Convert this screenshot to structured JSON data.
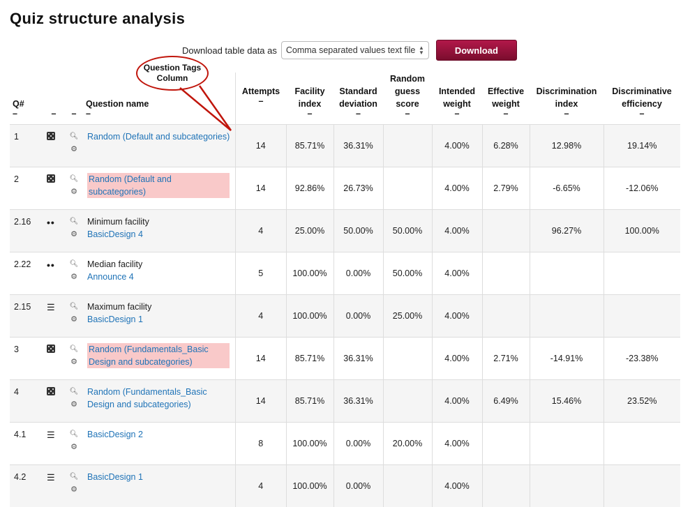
{
  "page_title": "Quiz structure analysis",
  "download": {
    "label": "Download table data as",
    "format": "Comma separated values text file",
    "button": "Download"
  },
  "annotation": {
    "line1": "Question Tags",
    "line2": "Column"
  },
  "headers": {
    "q": "Q#",
    "name": "Question name",
    "attempts": "Attempts",
    "facility": "Facility index",
    "stddev": "Standard deviation",
    "guess": "Random guess score",
    "intended": "Intended weight",
    "effective": "Effective weight",
    "disc_index": "Discrimination index",
    "disc_eff": "Discriminative efficiency",
    "sort_mark": "–"
  },
  "icons": {
    "preview": "search-icon",
    "settings": "gear-icon",
    "random": "dice-icon",
    "multi": "dots-icon",
    "list": "list-icon"
  },
  "rows": [
    {
      "q": "1",
      "name": "Random (Default and subcategories)",
      "sub": "",
      "link": true,
      "highlight": false,
      "icon": "dice",
      "attempts": "14",
      "facility": "85.71%",
      "stddev": "36.31%",
      "guess": "",
      "intended": "4.00%",
      "effective": "6.28%",
      "disc_index": "12.98%",
      "disc_eff": "19.14%"
    },
    {
      "q": "2",
      "name": "Random (Default and subcategories)",
      "sub": "",
      "link": true,
      "highlight": true,
      "icon": "dice",
      "attempts": "14",
      "facility": "92.86%",
      "stddev": "26.73%",
      "guess": "",
      "intended": "4.00%",
      "effective": "2.79%",
      "disc_index": "-6.65%",
      "disc_eff": "-12.06%"
    },
    {
      "q": "2.16",
      "name": "Minimum facility",
      "sub": "BasicDesign 4",
      "link": false,
      "highlight": false,
      "icon": "dots",
      "attempts": "4",
      "facility": "25.00%",
      "stddev": "50.00%",
      "guess": "50.00%",
      "intended": "4.00%",
      "effective": "",
      "disc_index": "96.27%",
      "disc_eff": "100.00%"
    },
    {
      "q": "2.22",
      "name": "Median facility",
      "sub": "Announce 4",
      "link": false,
      "highlight": false,
      "icon": "dots",
      "attempts": "5",
      "facility": "100.00%",
      "stddev": "0.00%",
      "guess": "50.00%",
      "intended": "4.00%",
      "effective": "",
      "disc_index": "",
      "disc_eff": ""
    },
    {
      "q": "2.15",
      "name": "Maximum facility",
      "sub": "BasicDesign 1",
      "link": false,
      "highlight": false,
      "icon": "list",
      "attempts": "4",
      "facility": "100.00%",
      "stddev": "0.00%",
      "guess": "25.00%",
      "intended": "4.00%",
      "effective": "",
      "disc_index": "",
      "disc_eff": ""
    },
    {
      "q": "3",
      "name": "Random (Fundamentals_Basic Design and subcategories)",
      "sub": "",
      "link": true,
      "highlight": true,
      "icon": "dice",
      "attempts": "14",
      "facility": "85.71%",
      "stddev": "36.31%",
      "guess": "",
      "intended": "4.00%",
      "effective": "2.71%",
      "disc_index": "-14.91%",
      "disc_eff": "-23.38%"
    },
    {
      "q": "4",
      "name": "Random (Fundamentals_Basic Design and subcategories)",
      "sub": "",
      "link": true,
      "highlight": false,
      "icon": "dice",
      "attempts": "14",
      "facility": "85.71%",
      "stddev": "36.31%",
      "guess": "",
      "intended": "4.00%",
      "effective": "6.49%",
      "disc_index": "15.46%",
      "disc_eff": "23.52%"
    },
    {
      "q": "4.1",
      "name": "BasicDesign 2",
      "sub": "",
      "link": true,
      "highlight": false,
      "icon": "list",
      "attempts": "8",
      "facility": "100.00%",
      "stddev": "0.00%",
      "guess": "20.00%",
      "intended": "4.00%",
      "effective": "",
      "disc_index": "",
      "disc_eff": ""
    },
    {
      "q": "4.2",
      "name": "BasicDesign 1",
      "sub": "",
      "link": true,
      "highlight": false,
      "icon": "list",
      "attempts": "4",
      "facility": "100.00%",
      "stddev": "0.00%",
      "guess": "",
      "intended": "4.00%",
      "effective": "",
      "disc_index": "",
      "disc_eff": ""
    }
  ]
}
